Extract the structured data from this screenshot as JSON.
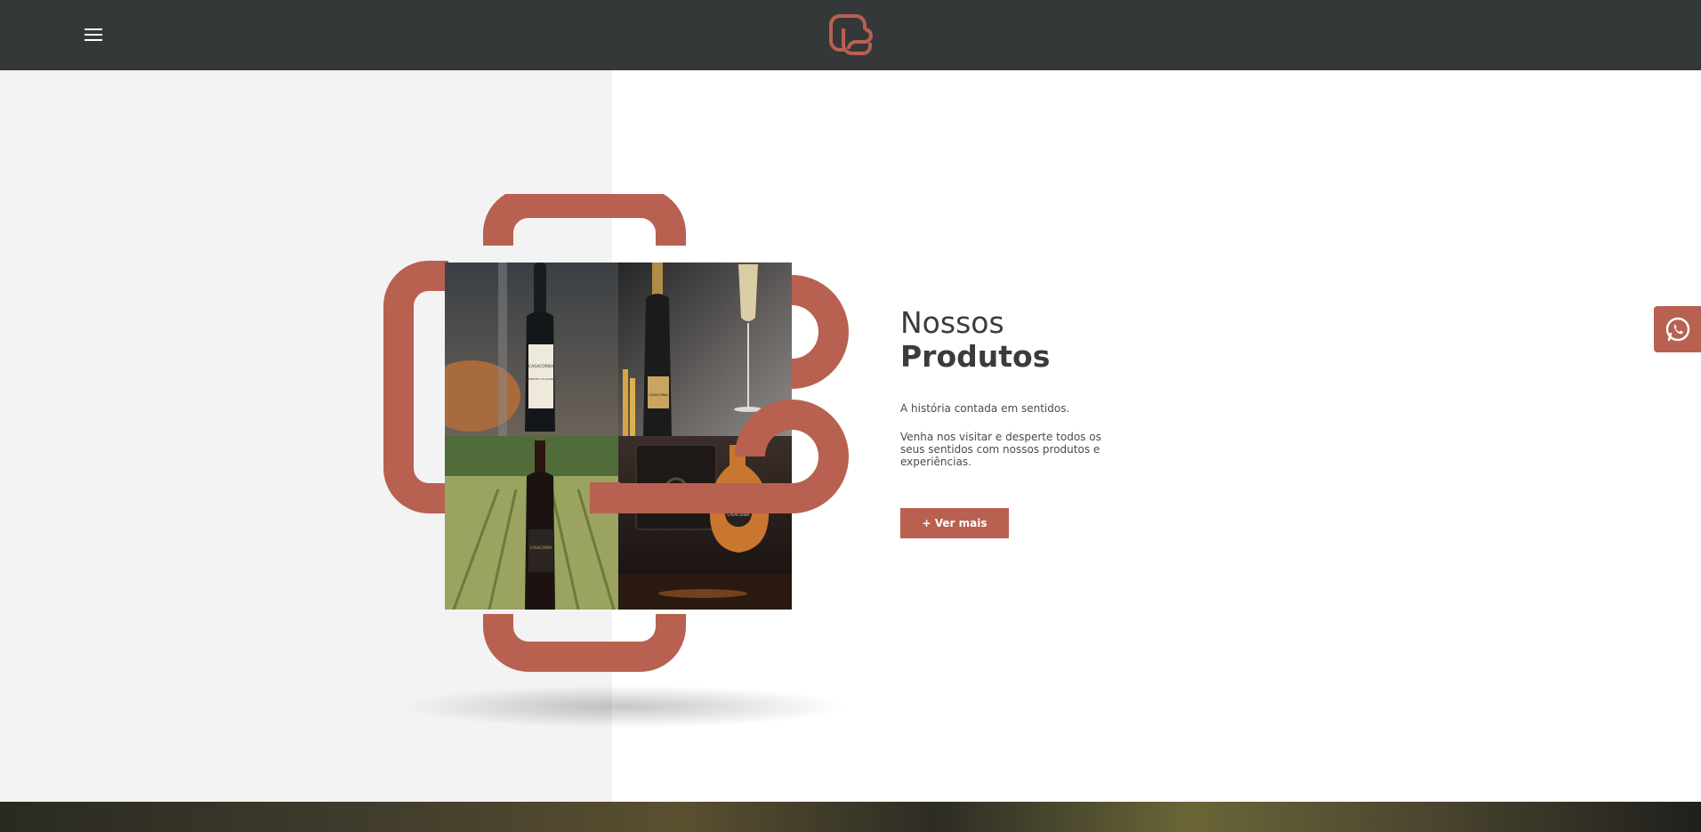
{
  "header": {
    "menu_icon": "hamburger-menu-icon",
    "logo_icon": "casacorba-logo-icon"
  },
  "products": {
    "title_line1": "Nossos",
    "title_line2": "Produtos",
    "tagline": "A história contada em sentidos.",
    "description": "Venha nos visitar e desperte todos os seus sentidos com nossos produtos e experiências.",
    "cta_label": "+ Ver mais",
    "image_labels": {
      "wine_bottle_1": "CASACORBA",
      "wine_bottle_1_variety": "CABERNET SAUVIGNON",
      "sparkling_bottle": "CASACORBA",
      "vineyard_bottle": "CASACORBA",
      "cognac_bottle": "CASACORBA"
    }
  },
  "floating": {
    "whatsapp_icon": "whatsapp-icon"
  },
  "colors": {
    "accent": "#b86150",
    "header_bg": "#353839",
    "panel_bg": "#f3f3f3",
    "text": "#3a3b3d"
  }
}
